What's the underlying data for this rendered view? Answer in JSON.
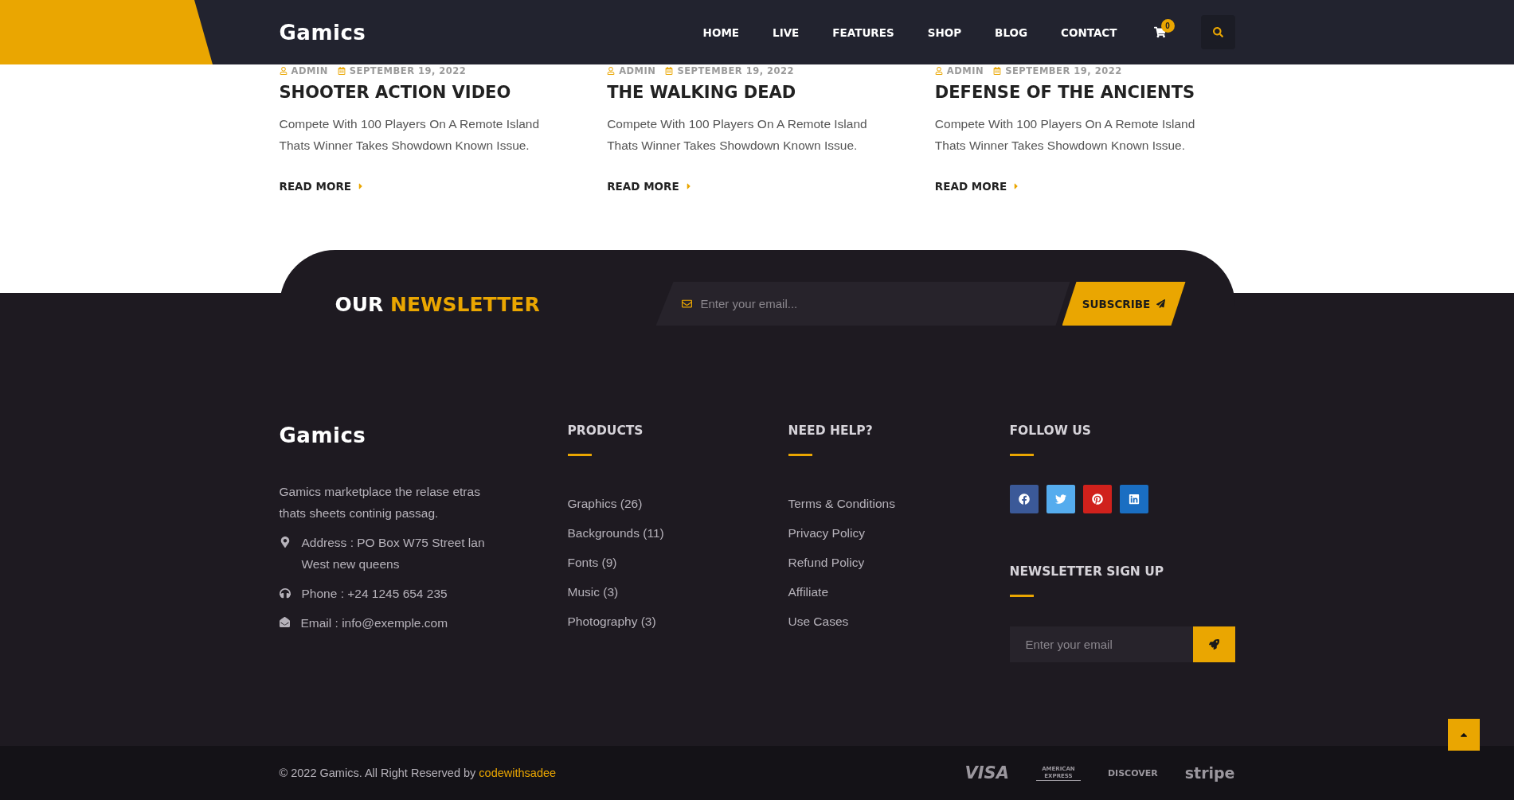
{
  "header": {
    "logo": "Gamics",
    "nav": [
      {
        "label": "HOME"
      },
      {
        "label": "LIVE"
      },
      {
        "label": "FEATURES"
      },
      {
        "label": "SHOP"
      },
      {
        "label": "BLOG"
      },
      {
        "label": "CONTACT"
      }
    ],
    "cart_count": "0"
  },
  "posts": [
    {
      "author": "ADMIN",
      "date": "SEPTEMBER 19, 2022",
      "title": "SHOOTER ACTION VIDEO",
      "excerpt": "Compete With 100 Players On A Remote Island Thats Winner Takes Showdown Known Issue.",
      "link": "READ MORE"
    },
    {
      "author": "ADMIN",
      "date": "SEPTEMBER 19, 2022",
      "title": "THE WALKING DEAD",
      "excerpt": "Compete With 100 Players On A Remote Island Thats Winner Takes Showdown Known Issue.",
      "link": "READ MORE"
    },
    {
      "author": "ADMIN",
      "date": "SEPTEMBER 19, 2022",
      "title": "DEFENSE OF THE ANCIENTS",
      "excerpt": "Compete With 100 Players On A Remote Island Thats Winner Takes Showdown Known Issue.",
      "link": "READ MORE"
    }
  ],
  "newsletter": {
    "title_start": "OUR",
    "title_highlight": "NEWSLETTER",
    "placeholder": "Enter your email...",
    "button": "SUBSCRIBE"
  },
  "footer": {
    "logo": "Gamics",
    "about": "Gamics marketplace the relase etras thats sheets continig passag.",
    "contacts": [
      {
        "kind": "address",
        "text": "Address : PO Box W75 Street lan West new queens"
      },
      {
        "kind": "phone",
        "text": "Phone : +24 1245 654 235"
      },
      {
        "kind": "email",
        "text": "Email : info@exemple.com"
      }
    ],
    "columns": [
      {
        "heading": "PRODUCTS",
        "links": [
          "Graphics (26)",
          "Backgrounds (11)",
          "Fonts (9)",
          "Music (3)",
          "Photography (3)"
        ]
      },
      {
        "heading": "NEED HELP?",
        "links": [
          "Terms & Conditions",
          "Privacy Policy",
          "Refund Policy",
          "Affiliate",
          "Use Cases"
        ]
      }
    ],
    "follow": {
      "heading": "FOLLOW US",
      "socials": [
        {
          "kind": "facebook",
          "color": "#3b5998"
        },
        {
          "kind": "twitter",
          "color": "#55acee"
        },
        {
          "kind": "pinterest",
          "color": "#d0211c"
        },
        {
          "kind": "linkedin",
          "color": "#1a6ec2"
        }
      ]
    },
    "signup": {
      "heading": "NEWSLETTER SIGN UP",
      "placeholder": "Enter your email"
    }
  },
  "bottom_bar": {
    "copyright": "© 2022 Gamics. All Right Reserved by",
    "author_link": "codewithsadee",
    "payment_methods": [
      {
        "kind": "visa",
        "label": "VISA"
      },
      {
        "kind": "amex",
        "label": "AMERICAN EXPRESS"
      },
      {
        "kind": "discover",
        "label": "DISCOVER"
      },
      {
        "kind": "stripe",
        "label": "stripe"
      }
    ]
  }
}
